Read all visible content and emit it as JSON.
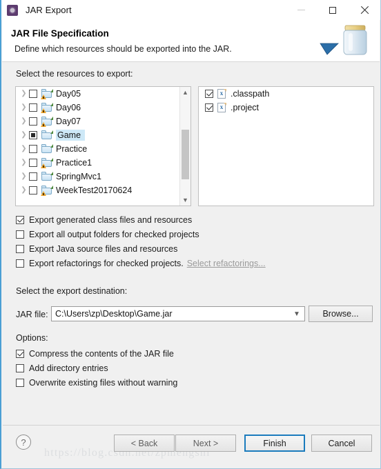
{
  "window": {
    "title": "JAR Export",
    "icon": "jar-export-icon",
    "controls": {
      "minimize": "minimize-icon",
      "maximize": "maximize-icon",
      "close": "close-icon"
    }
  },
  "header": {
    "title": "JAR File Specification",
    "description": "Define which resources should be exported into the JAR.",
    "graphic": "jar-with-arrow-icon"
  },
  "resources": {
    "label": "Select the resources to export:",
    "left_tree": [
      {
        "name": "Day05",
        "check": "unchecked",
        "icon": "folder-warning-icon",
        "expandable": true,
        "selected": false
      },
      {
        "name": "Day06",
        "check": "unchecked",
        "icon": "folder-warning-icon",
        "expandable": true,
        "selected": false
      },
      {
        "name": "Day07",
        "check": "unchecked",
        "icon": "folder-warning-icon",
        "expandable": true,
        "selected": false
      },
      {
        "name": "Game",
        "check": "partial",
        "icon": "folder-icon",
        "expandable": true,
        "selected": true
      },
      {
        "name": "Practice",
        "check": "unchecked",
        "icon": "folder-icon",
        "expandable": true,
        "selected": false
      },
      {
        "name": "Practice1",
        "check": "unchecked",
        "icon": "folder-warning-icon",
        "expandable": true,
        "selected": false
      },
      {
        "name": "SpringMvc1",
        "check": "unchecked",
        "icon": "folder-icon",
        "expandable": true,
        "selected": false
      },
      {
        "name": "WeekTest20170624",
        "check": "unchecked",
        "icon": "folder-warning-icon",
        "expandable": true,
        "selected": false
      }
    ],
    "right_tree": [
      {
        "name": ".classpath",
        "check": "checked",
        "icon": "xml-file-icon"
      },
      {
        "name": ".project",
        "check": "checked",
        "icon": "xml-file-icon"
      }
    ],
    "scrollbar": {
      "up": "chevron-up-icon",
      "down": "chevron-down-icon"
    }
  },
  "export_options": [
    {
      "label": "Export generated class files and resources",
      "checked": true
    },
    {
      "label": "Export all output folders for checked projects",
      "checked": false
    },
    {
      "label": "Export Java source files and resources",
      "checked": false
    },
    {
      "label": "Export refactorings for checked projects.",
      "checked": false,
      "link": "Select refactorings..."
    }
  ],
  "destination": {
    "label": "Select the export destination:",
    "jar_file_label": "JAR file:",
    "jar_file_value": "C:\\Users\\zp\\Desktop\\Game.jar",
    "browse_label": "Browse...",
    "chevron": "chevron-down-icon"
  },
  "options": {
    "label": "Options:",
    "items": [
      {
        "label": "Compress the contents of the JAR file",
        "checked": true
      },
      {
        "label": "Add directory entries",
        "checked": false
      },
      {
        "label": "Overwrite existing files without warning",
        "checked": false
      }
    ]
  },
  "footer": {
    "help": "?",
    "buttons": [
      {
        "id": "back",
        "label": "< Back",
        "enabled": false,
        "default": false
      },
      {
        "id": "next",
        "label": "Next >",
        "enabled": false,
        "default": false
      },
      {
        "id": "finish",
        "label": "Finish",
        "enabled": true,
        "default": true
      },
      {
        "id": "cancel",
        "label": "Cancel",
        "enabled": true,
        "default": false
      }
    ]
  },
  "watermark": "https://blog.csdn.net/zpmengshi",
  "colors": {
    "accent": "#1a7bbd",
    "selection": "#cde8f7",
    "dialog_bg": "#f0f0f0",
    "panel_bg": "#ffffff",
    "warning_badge": "#f0a830"
  }
}
